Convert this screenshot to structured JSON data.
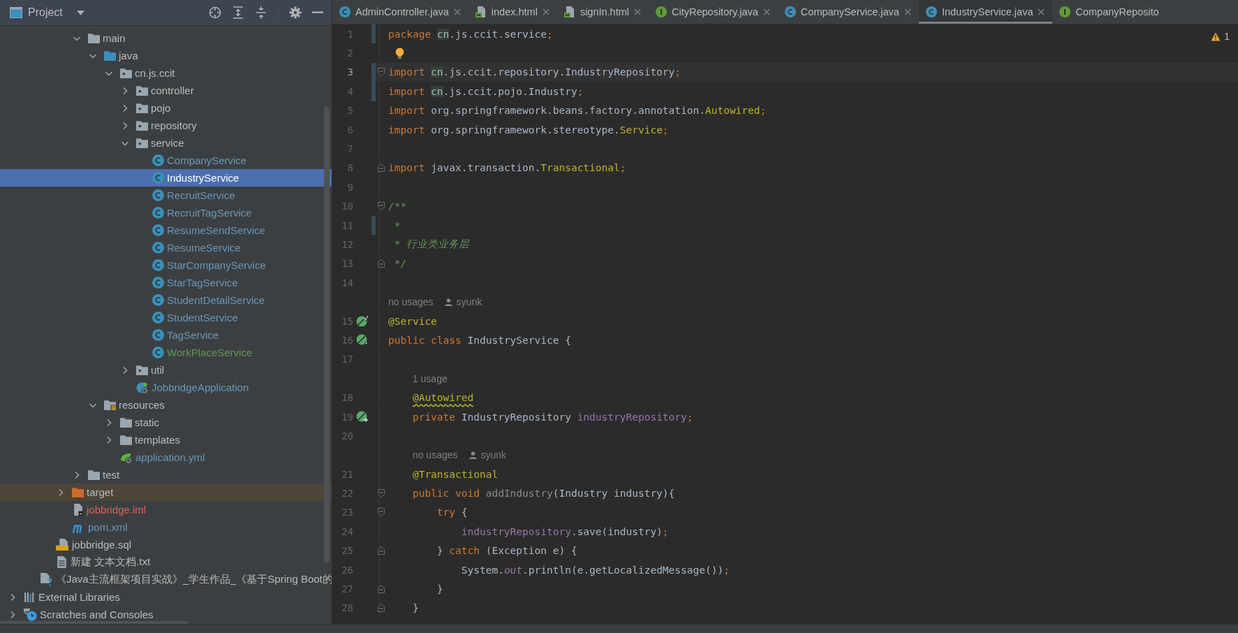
{
  "project_panel": {
    "title": "Project"
  },
  "tree": [
    {
      "children": [
        {
          "children": [
            {
              "children": [
                {
                  "children": [
                    {
                      "label": "main",
                      "kind": "folder",
                      "expanded": true,
                      "selected": false,
                      "color": "#bbbbbb",
                      "children": [
                        {
                          "label": "java",
                          "kind": "source-root",
                          "expanded": true,
                          "selected": false,
                          "color": "#bbbbbb",
                          "children": [
                            {
                              "label": "cn.js.ccit",
                              "kind": "package",
                              "expanded": true,
                              "selected": false,
                              "color": "#bbbbbb",
                              "children": [
                                {
                                  "label": "controller",
                                  "kind": "package",
                                  "expanded": false,
                                  "selected": false,
                                  "color": "#bbbbbb"
                                },
                                {
                                  "label": "pojo",
                                  "kind": "package",
                                  "expanded": false,
                                  "selected": false,
                                  "color": "#bbbbbb"
                                },
                                {
                                  "label": "repository",
                                  "kind": "package",
                                  "expanded": false,
                                  "selected": false,
                                  "color": "#bbbbbb"
                                },
                                {
                                  "label": "service",
                                  "kind": "package",
                                  "expanded": true,
                                  "selected": false,
                                  "color": "#bbbbbb",
                                  "children": [
                                    {
                                      "label": "CompanyService",
                                      "kind": "class",
                                      "selected": false,
                                      "color": "#6897bb"
                                    },
                                    {
                                      "label": "IndustryService",
                                      "kind": "class",
                                      "selected": true,
                                      "color": "#ffffff"
                                    },
                                    {
                                      "label": "RecruitService",
                                      "kind": "class",
                                      "selected": false,
                                      "color": "#6897bb"
                                    },
                                    {
                                      "label": "RecruitTagService",
                                      "kind": "class",
                                      "selected": false,
                                      "color": "#6897bb"
                                    },
                                    {
                                      "label": "ResumeSendService",
                                      "kind": "class",
                                      "selected": false,
                                      "color": "#6897bb"
                                    },
                                    {
                                      "label": "ResumeService",
                                      "kind": "class",
                                      "selected": false,
                                      "color": "#6897bb"
                                    },
                                    {
                                      "label": "StarCompanyService",
                                      "kind": "class",
                                      "selected": false,
                                      "color": "#6897bb"
                                    },
                                    {
                                      "label": "StarTagService",
                                      "kind": "class",
                                      "selected": false,
                                      "color": "#6897bb"
                                    },
                                    {
                                      "label": "StudentDetailService",
                                      "kind": "class",
                                      "selected": false,
                                      "color": "#6897bb"
                                    },
                                    {
                                      "label": "StudentService",
                                      "kind": "class",
                                      "selected": false,
                                      "color": "#6897bb"
                                    },
                                    {
                                      "label": "TagService",
                                      "kind": "class",
                                      "selected": false,
                                      "color": "#6897bb"
                                    },
                                    {
                                      "label": "WorkPlaceService",
                                      "kind": "class",
                                      "selected": false,
                                      "color": "#629755"
                                    }
                                  ]
                                },
                                {
                                  "label": "util",
                                  "kind": "package",
                                  "expanded": false,
                                  "selected": false,
                                  "color": "#bbbbbb"
                                },
                                {
                                  "label": "JobbridgeApplication",
                                  "kind": "spring-class",
                                  "selected": false,
                                  "color": "#6897bb"
                                }
                              ]
                            }
                          ]
                        },
                        {
                          "label": "resources",
                          "kind": "resources-root",
                          "expanded": true,
                          "selected": false,
                          "color": "#bbbbbb",
                          "children": [
                            {
                              "label": "static",
                              "kind": "folder",
                              "expanded": false,
                              "selected": false,
                              "color": "#bbbbbb"
                            },
                            {
                              "label": "templates",
                              "kind": "folder",
                              "expanded": false,
                              "selected": false,
                              "color": "#bbbbbb"
                            },
                            {
                              "label": "application.yml",
                              "kind": "yml",
                              "selected": false,
                              "color": "#6897bb"
                            }
                          ]
                        }
                      ]
                    },
                    {
                      "label": "test",
                      "kind": "folder",
                      "expanded": false,
                      "selected": false,
                      "color": "#bbbbbb"
                    }
                  ]
                },
                {
                  "label": "target",
                  "kind": "excluded-folder",
                  "expanded": false,
                  "selected": false,
                  "color": "#bbbbbb"
                },
                {
                  "label": "jobbridge.iml",
                  "kind": "iml",
                  "selected": false,
                  "color": "#d1675a"
                },
                {
                  "label": "pom.xml",
                  "kind": "maven",
                  "selected": false,
                  "color": "#6897bb"
                }
              ]
            },
            {
              "label": "jobbridge.sql",
              "kind": "sql",
              "selected": false,
              "color": "#bbbbbb"
            },
            {
              "label": "新建 文本文档.txt",
              "kind": "text",
              "selected": false,
              "color": "#bbbbbb"
            }
          ]
        },
        {
          "label": "《Java主流框架项目实战》_学生作品_《基于Spring Boot的",
          "kind": "unknown",
          "selected": false,
          "color": "#bbbbbb"
        }
      ]
    },
    {
      "label": "External Libraries",
      "kind": "libraries",
      "expanded": false,
      "selected": false,
      "color": "#bbbbbb"
    },
    {
      "label": "Scratches and Consoles",
      "kind": "scratches",
      "expanded": false,
      "selected": false,
      "color": "#bbbbbb"
    }
  ],
  "tabs": [
    {
      "label": "AdminController.java",
      "kind": "class",
      "selected": false,
      "close_button": true
    },
    {
      "label": "index.html",
      "kind": "html",
      "selected": false,
      "close_button": true
    },
    {
      "label": "signIn.html",
      "kind": "html",
      "selected": false,
      "close_button": true
    },
    {
      "label": "CityRepository.java",
      "kind": "interface",
      "selected": false,
      "close_button": true
    },
    {
      "label": "CompanyService.java",
      "kind": "class",
      "selected": false,
      "close_button": true
    },
    {
      "label": "IndustryService.java",
      "kind": "class",
      "selected": true,
      "close_button": true
    },
    {
      "label": "CompanyReposito",
      "kind": "interface",
      "selected": false,
      "close_button": false
    }
  ],
  "inspections": {
    "warnings": "1"
  },
  "editor": {
    "lines": [
      {
        "number": "1",
        "changed": true,
        "current": false,
        "tokens": [
          {
            "text": "package ",
            "kind": "kw"
          },
          {
            "text": "cn",
            "kind": "match"
          },
          {
            "text": ".js.ccit.service",
            "kind": "plain"
          },
          {
            "text": ";",
            "kind": "kw"
          }
        ]
      },
      {
        "number": "2",
        "changed": false,
        "current": false,
        "icons": [
          {
            "kind": "bulb"
          }
        ]
      },
      {
        "number": "3",
        "changed": true,
        "current": true,
        "icons": [
          {
            "kind": "fold-start"
          }
        ],
        "tokens": [
          {
            "text": "import ",
            "kind": "kw"
          },
          {
            "text": "cn",
            "kind": "match"
          },
          {
            "text": ".js.ccit.repository.IndustryRepository",
            "kind": "plain"
          },
          {
            "text": ";",
            "kind": "kw"
          }
        ]
      },
      {
        "number": "4",
        "changed": true,
        "current": false,
        "tokens": [
          {
            "text": "import ",
            "kind": "kw"
          },
          {
            "text": "cn",
            "kind": "match"
          },
          {
            "text": ".js.ccit.pojo.Industry",
            "kind": "plain"
          },
          {
            "text": ";",
            "kind": "kw"
          }
        ]
      },
      {
        "number": "5",
        "changed": false,
        "current": false,
        "tokens": [
          {
            "text": "import",
            "kind": "kw"
          },
          {
            "text": " org.springframework.beans.factory.annotation.",
            "kind": "plain"
          },
          {
            "text": "Autowired",
            "kind": "ann"
          },
          {
            "text": ";",
            "kind": "kw"
          }
        ]
      },
      {
        "number": "6",
        "changed": false,
        "current": false,
        "tokens": [
          {
            "text": "import",
            "kind": "kw"
          },
          {
            "text": " org.springframework.stereotype.",
            "kind": "plain"
          },
          {
            "text": "Service",
            "kind": "ann"
          },
          {
            "text": ";",
            "kind": "kw"
          }
        ]
      },
      {
        "number": "7",
        "changed": false,
        "current": false
      },
      {
        "number": "8",
        "changed": false,
        "current": false,
        "icons": [
          {
            "kind": "fold-end"
          }
        ],
        "tokens": [
          {
            "text": "import",
            "kind": "kw"
          },
          {
            "text": " javax.transaction.",
            "kind": "plain"
          },
          {
            "text": "Transactional",
            "kind": "ann"
          },
          {
            "text": ";",
            "kind": "kw"
          }
        ]
      },
      {
        "number": "9",
        "changed": false,
        "current": false
      },
      {
        "number": "10",
        "changed": false,
        "current": false,
        "icons": [
          {
            "kind": "fold-start"
          }
        ],
        "tokens": [
          {
            "text": "/**",
            "kind": "doc"
          }
        ]
      },
      {
        "number": "11",
        "changed": true,
        "current": false,
        "tokens": [
          {
            "text": " *",
            "kind": "doc"
          }
        ]
      },
      {
        "number": "12",
        "changed": false,
        "current": false,
        "tokens": [
          {
            "text": " * 行业类业务层",
            "kind": "doc"
          }
        ]
      },
      {
        "number": "13",
        "changed": false,
        "current": false,
        "icons": [
          {
            "kind": "fold-end"
          }
        ],
        "tokens": [
          {
            "text": " */",
            "kind": "doc"
          }
        ]
      },
      {
        "number": "14",
        "changed": false,
        "current": false
      },
      {
        "number": "15",
        "changed": false,
        "current": false,
        "icons": [
          {
            "kind": "bean"
          }
        ],
        "hint": {
          "usages": "no usages",
          "author": "syunk"
        },
        "tokens": [
          {
            "text": "@Service",
            "kind": "ann"
          }
        ]
      },
      {
        "number": "16",
        "changed": false,
        "current": false,
        "icons": [
          {
            "kind": "bean-down"
          }
        ],
        "tokens": [
          {
            "text": "public ",
            "kind": "kw"
          },
          {
            "text": "class ",
            "kind": "kw"
          },
          {
            "text": "IndustryService {",
            "kind": "plain"
          }
        ]
      },
      {
        "number": "17",
        "changed": false,
        "current": false
      },
      {
        "number": "18",
        "changed": false,
        "current": false,
        "hint": {
          "usages": "1 usage"
        },
        "tokens": [
          {
            "text": "    @Autowired",
            "kind": "ann-warn"
          }
        ]
      },
      {
        "number": "19",
        "changed": false,
        "current": false,
        "icons": [
          {
            "kind": "bean-inject"
          }
        ],
        "tokens": [
          {
            "text": "    private",
            "kind": "kw"
          },
          {
            "text": " IndustryRepository ",
            "kind": "plain"
          },
          {
            "text": "industryRepository",
            "kind": "field"
          },
          {
            "text": ";",
            "kind": "kw"
          }
        ]
      },
      {
        "number": "20",
        "changed": false,
        "current": false
      },
      {
        "number": "21",
        "changed": false,
        "current": false,
        "hint": {
          "usages": "no usages",
          "author": "syunk"
        },
        "tokens": [
          {
            "text": "    @Transactional",
            "kind": "ann"
          }
        ]
      },
      {
        "number": "22",
        "changed": false,
        "current": false,
        "icons": [
          {
            "kind": "fold-start"
          }
        ],
        "tokens": [
          {
            "text": "    public ",
            "kind": "kw"
          },
          {
            "text": "void ",
            "kind": "kw"
          },
          {
            "text": "addIndustry",
            "kind": "unused"
          },
          {
            "text": "(Industry industry){",
            "kind": "plain"
          }
        ]
      },
      {
        "number": "23",
        "changed": false,
        "current": false,
        "icons": [
          {
            "kind": "fold-start"
          }
        ],
        "tokens": [
          {
            "text": "        try",
            "kind": "kw"
          },
          {
            "text": " {",
            "kind": "plain"
          }
        ]
      },
      {
        "number": "24",
        "changed": false,
        "current": false,
        "tokens": [
          {
            "text": "            industryRepository",
            "kind": "field"
          },
          {
            "text": ".save(industry)",
            "kind": "plain"
          },
          {
            "text": ";",
            "kind": "kw"
          }
        ]
      },
      {
        "number": "25",
        "changed": false,
        "current": false,
        "icons": [
          {
            "kind": "fold-end"
          }
        ],
        "tokens": [
          {
            "text": "        } ",
            "kind": "plain"
          },
          {
            "text": "catch",
            "kind": "kw"
          },
          {
            "text": " (Exception e) {",
            "kind": "plain"
          }
        ]
      },
      {
        "number": "26",
        "changed": false,
        "current": false,
        "tokens": [
          {
            "text": "            System.",
            "kind": "plain"
          },
          {
            "text": "out",
            "kind": "static"
          },
          {
            "text": ".println(e.getLocalizedMessage())",
            "kind": "plain"
          },
          {
            "text": ";",
            "kind": "kw"
          }
        ]
      },
      {
        "number": "27",
        "changed": false,
        "current": false,
        "icons": [
          {
            "kind": "fold-end"
          }
        ],
        "tokens": [
          {
            "text": "        }",
            "kind": "plain"
          }
        ]
      },
      {
        "number": "28",
        "changed": false,
        "current": false,
        "icons": [
          {
            "kind": "fold-end"
          }
        ],
        "tokens": [
          {
            "text": "    }",
            "kind": "plain"
          }
        ]
      }
    ]
  }
}
